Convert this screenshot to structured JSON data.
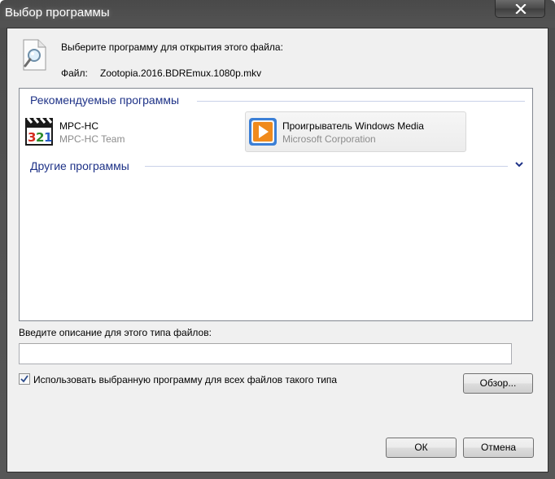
{
  "window": {
    "title": "Выбор программы"
  },
  "header": {
    "prompt": "Выберите программу для открытия этого файла:",
    "file_label": "Файл:",
    "file_name": "Zootopia.2016.BDREmux.1080p.mkv"
  },
  "programs": {
    "recommended_header": "Рекомендуемые программы",
    "other_header": "Другие программы",
    "items": [
      {
        "name": "MPC-HC",
        "company": "MPC-HC Team",
        "icon": "mpc-hc-icon"
      },
      {
        "name": "Проигрыватель Windows Media",
        "company": "Microsoft Corporation",
        "icon": "windows-media-player-icon",
        "selected": true
      }
    ]
  },
  "description": {
    "label": "Введите описание для этого типа файлов:",
    "value": ""
  },
  "always_use": {
    "label": "Использовать выбранную программу для всех файлов такого типа",
    "checked": true
  },
  "buttons": {
    "browse": "Обзор...",
    "ok": "ОК",
    "cancel": "Отмена"
  },
  "colors": {
    "group_header": "#1e3287",
    "company_text": "#8c8c8c",
    "wmp_orange": "#f08a1c",
    "wmp_blue": "#3b7fd6"
  }
}
